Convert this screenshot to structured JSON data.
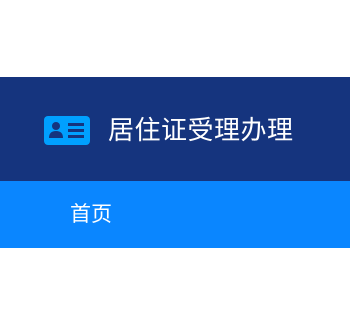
{
  "header": {
    "logo_icon": "id-card-icon",
    "title": "居住证受理办理",
    "background_color": "#15347e",
    "logo_color": "#00a0ff"
  },
  "nav": {
    "background_color": "#0a86ff",
    "items": [
      {
        "label": "首页"
      }
    ]
  }
}
